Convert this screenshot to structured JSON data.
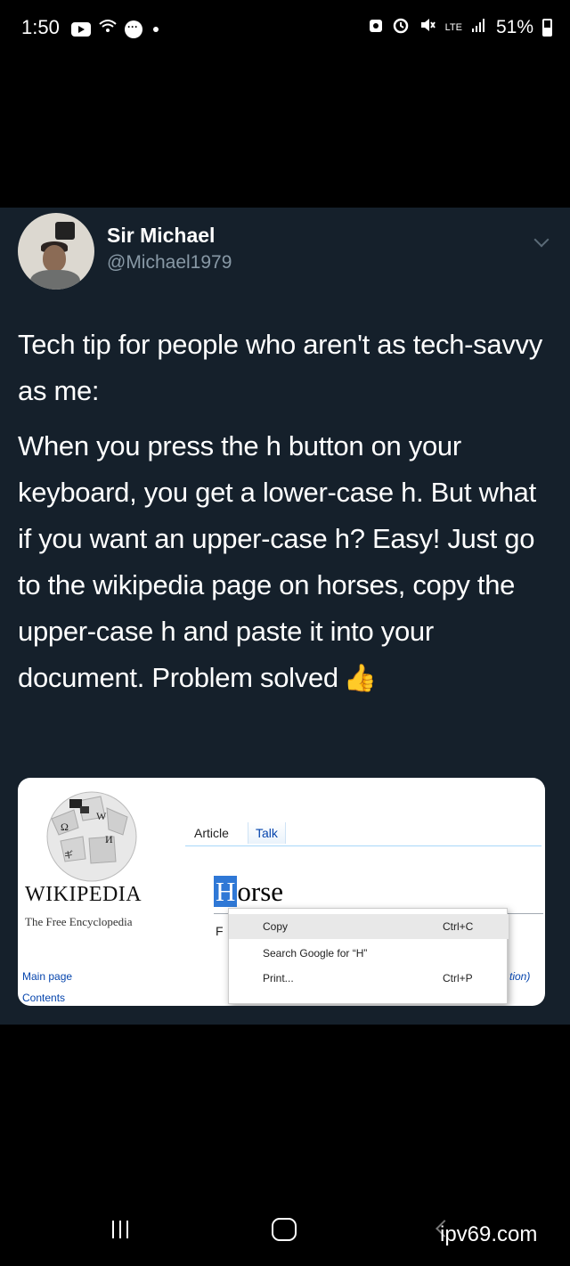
{
  "status_bar": {
    "time": "1:50",
    "icons_left": [
      "youtube-icon",
      "wifi-calling-icon",
      "messenger-icon",
      "dot-icon"
    ],
    "icons_right": [
      "app-icon",
      "alarm-icon",
      "mute-icon",
      "lte-icon",
      "signal-icon"
    ],
    "lte": "LTE",
    "battery": "51%"
  },
  "tweet": {
    "author": {
      "name": "Sir Michael",
      "handle": "@Michael1979"
    },
    "text_p1": "Tech tip for people who aren't as tech-savvy as me:",
    "text_p2": "When you press the h button on your keyboard, you get a lower-case h. But what if you want an upper-case h? Easy! Just go to the wikipedia page on horses, copy the upper-case h and paste it into your document. Problem solved",
    "emoji": "👍",
    "media": {
      "logo_word": "WIKIPEDIA",
      "logo_tagline": "The Free Encyclopedia",
      "globe_glyphs": [
        "Ω",
        "W",
        "И",
        "ギ"
      ],
      "nav_links": [
        "Main page",
        "Contents"
      ],
      "tabs": [
        "Article",
        "Talk"
      ],
      "page_title_first": "H",
      "page_title_rest": "orse",
      "body_fragment": "F",
      "context_menu": [
        {
          "label": "Copy",
          "shortcut": "Ctrl+C",
          "highlighted": true
        },
        {
          "label": "Search Google for “H”",
          "shortcut": "",
          "highlighted": false
        },
        {
          "label": "Print...",
          "shortcut": "Ctrl+P",
          "highlighted": false
        }
      ],
      "trailing_text": "tion)"
    }
  },
  "watermark": "ipv69.com"
}
